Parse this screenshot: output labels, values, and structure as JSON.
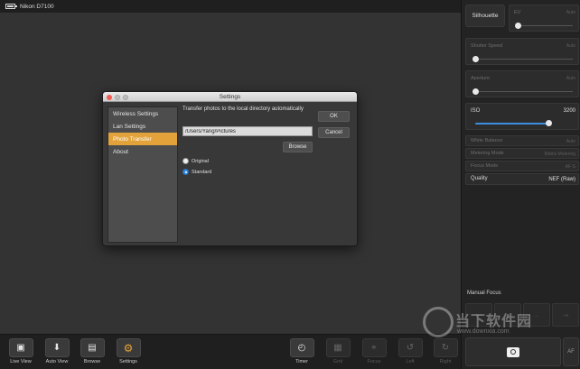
{
  "topbar": {
    "camera_name": "Nikon D7100"
  },
  "dialog": {
    "title": "Settings",
    "nav_items": [
      {
        "label": "Wireless Settings",
        "active": false
      },
      {
        "label": "Lan Settings",
        "active": false
      },
      {
        "label": "Photo Transfer",
        "active": true
      },
      {
        "label": "About",
        "active": false
      }
    ],
    "description": "Transfer photos to the local directory automatically",
    "path_value": "/Users/Yang/Pictures",
    "browse_label": "Browse",
    "ok_label": "OK",
    "cancel_label": "Cancel",
    "radio_options": [
      {
        "label": "Original",
        "selected": false
      },
      {
        "label": "Standard",
        "selected": true
      }
    ]
  },
  "right_panel": {
    "silhouette_label": "Silhouette",
    "ev": {
      "label": "EV",
      "value": "Auto"
    },
    "shutter_speed": {
      "label": "Shutter Speed",
      "value": "Auto"
    },
    "aperture": {
      "label": "Aperture",
      "value": "Auto"
    },
    "iso": {
      "label": "ISO",
      "value": "3200"
    },
    "white_balance": {
      "label": "White Balance",
      "value": "Auto"
    },
    "metering_mode": {
      "label": "Metering Mode",
      "value": "Matrix Metering"
    },
    "focus_mode": {
      "label": "Focus Mode",
      "value": "AF-S"
    },
    "quality": {
      "label": "Quality",
      "value": "NEF (Raw)"
    },
    "manual_focus_label": "Manual Focus",
    "af_label": "AF"
  },
  "toolbar": {
    "left": [
      {
        "label": "Live View",
        "icon": "camera-icon"
      },
      {
        "label": "Auto View",
        "icon": "inbox-icon"
      },
      {
        "label": "Browse",
        "icon": "photos-icon"
      },
      {
        "label": "Settings",
        "icon": "gear-icon"
      }
    ],
    "right": [
      {
        "label": "Timer",
        "icon": "timer-icon"
      },
      {
        "label": "Grid",
        "icon": "grid-icon"
      },
      {
        "label": "Focus",
        "icon": "focus-icon"
      },
      {
        "label": "Left",
        "icon": "rotate-left-icon"
      },
      {
        "label": "Right",
        "icon": "rotate-right-icon"
      }
    ]
  },
  "watermark": {
    "text": "当下软件园",
    "url": "www.downxia.com"
  },
  "colors": {
    "accent": "#e3a33a",
    "iso_blue": "#3b8de0"
  }
}
